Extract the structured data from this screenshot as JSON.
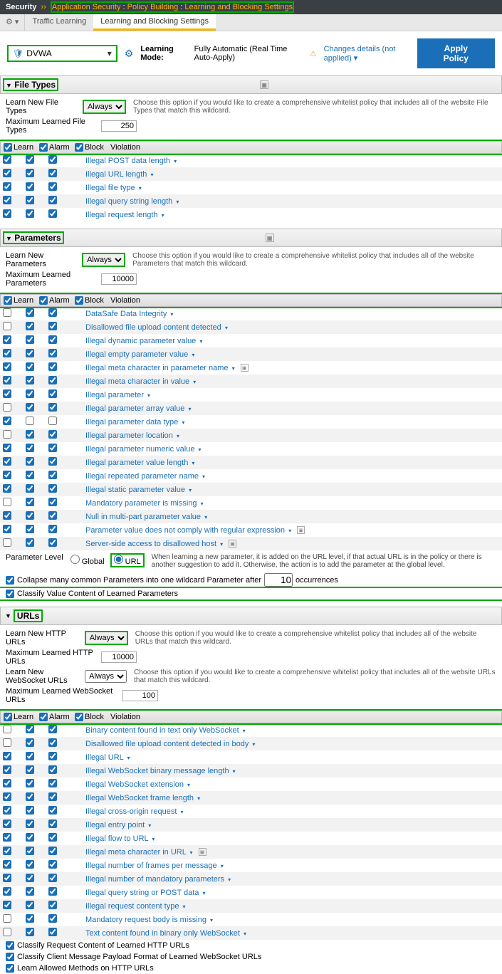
{
  "breadcrumb": {
    "root": "Security",
    "p1": "Application Security",
    "p2": "Policy Building",
    "p3": "Learning and Blocking Settings"
  },
  "tabs": {
    "t1": "Traffic Learning",
    "t2": "Learning and Blocking Settings"
  },
  "policy_name": "DVWA",
  "learning_mode_label": "Learning Mode:",
  "learning_mode_value": "Fully Automatic (Real Time Auto-Apply)",
  "changes_text": "Changes details (not applied)",
  "apply_btn": "Apply Policy",
  "sections": {
    "filetypes": {
      "title": "File Types",
      "learn_label": "Learn New File Types",
      "learn_value": "Always",
      "learn_hint": "Choose this option if you would like to create a comprehensive whitelist policy that includes all of the website File Types that match this wildcard.",
      "max_label": "Maximum Learned File Types",
      "max_value": "250",
      "cols": {
        "c1": "Learn",
        "c2": "Alarm",
        "c3": "Block",
        "c4": "Violation"
      },
      "rows": [
        {
          "l": true,
          "a": true,
          "b": true,
          "name": "Illegal POST data length"
        },
        {
          "l": true,
          "a": true,
          "b": true,
          "name": "Illegal URL length"
        },
        {
          "l": true,
          "a": true,
          "b": true,
          "name": "Illegal file type"
        },
        {
          "l": true,
          "a": true,
          "b": true,
          "name": "Illegal query string length"
        },
        {
          "l": true,
          "a": true,
          "b": true,
          "name": "Illegal request length"
        }
      ]
    },
    "parameters": {
      "title": "Parameters",
      "learn_label": "Learn New Parameters",
      "learn_value": "Always",
      "learn_hint": "Choose this option if you would like to create a comprehensive whitelist policy that includes all of the website Parameters that match this wildcard.",
      "max_label": "Maximum Learned Parameters",
      "max_value": "10000",
      "cols": {
        "c1": "Learn",
        "c2": "Alarm",
        "c3": "Block",
        "c4": "Violation"
      },
      "rows": [
        {
          "l": false,
          "a": true,
          "b": true,
          "name": "DataSafe Data Integrity"
        },
        {
          "l": false,
          "a": true,
          "b": true,
          "name": "Disallowed file upload content detected"
        },
        {
          "l": true,
          "a": true,
          "b": true,
          "name": "Illegal dynamic parameter value"
        },
        {
          "l": true,
          "a": true,
          "b": true,
          "name": "Illegal empty parameter value"
        },
        {
          "l": true,
          "a": true,
          "b": true,
          "name": "Illegal meta character in parameter name",
          "sq": true
        },
        {
          "l": true,
          "a": true,
          "b": true,
          "name": "Illegal meta character in value"
        },
        {
          "l": true,
          "a": true,
          "b": true,
          "name": "Illegal parameter"
        },
        {
          "l": false,
          "a": true,
          "b": true,
          "name": "Illegal parameter array value"
        },
        {
          "l": true,
          "a": false,
          "b": false,
          "name": "Illegal parameter data type"
        },
        {
          "l": false,
          "a": true,
          "b": true,
          "name": "Illegal parameter location"
        },
        {
          "l": true,
          "a": true,
          "b": true,
          "name": "Illegal parameter numeric value"
        },
        {
          "l": true,
          "a": true,
          "b": true,
          "name": "Illegal parameter value length"
        },
        {
          "l": true,
          "a": true,
          "b": true,
          "name": "Illegal repeated parameter name"
        },
        {
          "l": true,
          "a": true,
          "b": true,
          "name": "Illegal static parameter value"
        },
        {
          "l": false,
          "a": true,
          "b": true,
          "name": "Mandatory parameter is missing"
        },
        {
          "l": true,
          "a": true,
          "b": true,
          "name": "Null in multi-part parameter value"
        },
        {
          "l": true,
          "a": true,
          "b": true,
          "name": "Parameter value does not comply with regular expression",
          "sq": true
        },
        {
          "l": false,
          "a": true,
          "b": true,
          "name": "Server-side access to disallowed host",
          "sq": true
        }
      ],
      "plevel_label": "Parameter Level",
      "plevel_global": "Global",
      "plevel_url": "URL",
      "plevel_desc": "When learning a new parameter, it is added on the URL level, if that actual URL is in the policy or there is another suggestion to add it. Otherwise, the action is to add the parameter at the global level.",
      "collapse_label": "Collapse many common Parameters into one wildcard Parameter after",
      "collapse_value": "10",
      "collapse_suffix": "occurrences",
      "classify_label": "Classify Value Content of Learned Parameters"
    },
    "urls": {
      "title": "URLs",
      "learn_http_label": "Learn New HTTP URLs",
      "learn_http_value": "Always",
      "http_hint": "Choose this option if you would like to create a comprehensive whitelist policy that includes all of the website URLs that match this wildcard.",
      "max_http_label": "Maximum Learned HTTP URLs",
      "max_http_value": "10000",
      "learn_ws_label": "Learn New WebSocket URLs",
      "learn_ws_value": "Always",
      "ws_hint": "Choose this option if you would like to create a comprehensive whitelist policy that includes all of the website URLs that match this wildcard.",
      "max_ws_label": "Maximum Learned WebSocket URLs",
      "max_ws_value": "100",
      "cols": {
        "c1": "Learn",
        "c2": "Alarm",
        "c3": "Block",
        "c4": "Violation"
      },
      "rows": [
        {
          "l": false,
          "a": true,
          "b": true,
          "name": "Binary content found in text only WebSocket"
        },
        {
          "l": false,
          "a": true,
          "b": true,
          "name": "Disallowed file upload content detected in body"
        },
        {
          "l": true,
          "a": true,
          "b": true,
          "name": "Illegal URL"
        },
        {
          "l": true,
          "a": true,
          "b": true,
          "name": "Illegal WebSocket binary message length"
        },
        {
          "l": true,
          "a": true,
          "b": true,
          "name": "Illegal WebSocket extension"
        },
        {
          "l": true,
          "a": true,
          "b": true,
          "name": "Illegal WebSocket frame length"
        },
        {
          "l": true,
          "a": true,
          "b": true,
          "name": "Illegal cross-origin request"
        },
        {
          "l": true,
          "a": true,
          "b": true,
          "name": "Illegal entry point"
        },
        {
          "l": true,
          "a": true,
          "b": true,
          "name": "Illegal flow to URL"
        },
        {
          "l": true,
          "a": true,
          "b": true,
          "name": "Illegal meta character in URL",
          "sq": true
        },
        {
          "l": true,
          "a": true,
          "b": true,
          "name": "Illegal number of frames per message"
        },
        {
          "l": true,
          "a": true,
          "b": true,
          "name": "Illegal number of mandatory parameters"
        },
        {
          "l": true,
          "a": true,
          "b": true,
          "name": "Illegal query string or POST data"
        },
        {
          "l": true,
          "a": true,
          "b": true,
          "name": "Illegal request content type"
        },
        {
          "l": false,
          "a": true,
          "b": true,
          "name": "Mandatory request body is missing"
        },
        {
          "l": false,
          "a": true,
          "b": true,
          "name": "Text content found in binary only WebSocket"
        }
      ],
      "chk1": "Classify Request Content of Learned HTTP URLs",
      "chk2": "Classify Client Message Payload Format of Learned WebSocket URLs",
      "chk3": "Learn Allowed Methods on HTTP URLs"
    }
  }
}
